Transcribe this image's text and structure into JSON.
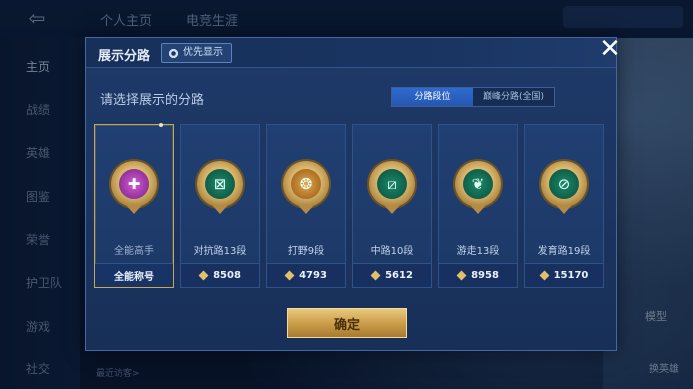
{
  "background": {
    "top_tabs": [
      "个人主页",
      "电竞生涯"
    ],
    "sidebar_items": [
      "主页",
      "战绩",
      "英雄",
      "图鉴",
      "荣誉",
      "护卫队",
      "游戏",
      "社交"
    ],
    "active_sidebar_index": 0,
    "right_labels": [
      "模型",
      "换英雄"
    ],
    "bottom_hint": "最近访客>"
  },
  "modal": {
    "title": "展示分路",
    "priority_label": "优先显示",
    "prompt": "请选择展示的分路",
    "toggle": {
      "options": [
        "分路段位",
        "巅峰分路(全国)"
      ],
      "selected_index": 0
    },
    "cards": [
      {
        "label": "全能高手",
        "foot": "全能称号",
        "icon": "all-round-badge-icon",
        "color": "pink",
        "selected": true
      },
      {
        "label": "对抗路13段",
        "foot": "8508",
        "icon": "clash-lane-badge-icon",
        "color": "green",
        "selected": false
      },
      {
        "label": "打野9段",
        "foot": "4793",
        "icon": "jungle-badge-icon",
        "color": "gold",
        "selected": false
      },
      {
        "label": "中路10段",
        "foot": "5612",
        "icon": "mid-lane-badge-icon",
        "color": "green",
        "selected": false
      },
      {
        "label": "游走13段",
        "foot": "8958",
        "icon": "roam-badge-icon",
        "color": "green",
        "selected": false
      },
      {
        "label": "发育路19段",
        "foot": "15170",
        "icon": "farm-lane-badge-icon",
        "color": "green",
        "selected": false
      }
    ],
    "confirm_label": "确定"
  },
  "colors": {
    "accent_gold": "#c9a655",
    "toggle_selected": "#2f6bd0",
    "modal_bg": "#1e3a68"
  }
}
